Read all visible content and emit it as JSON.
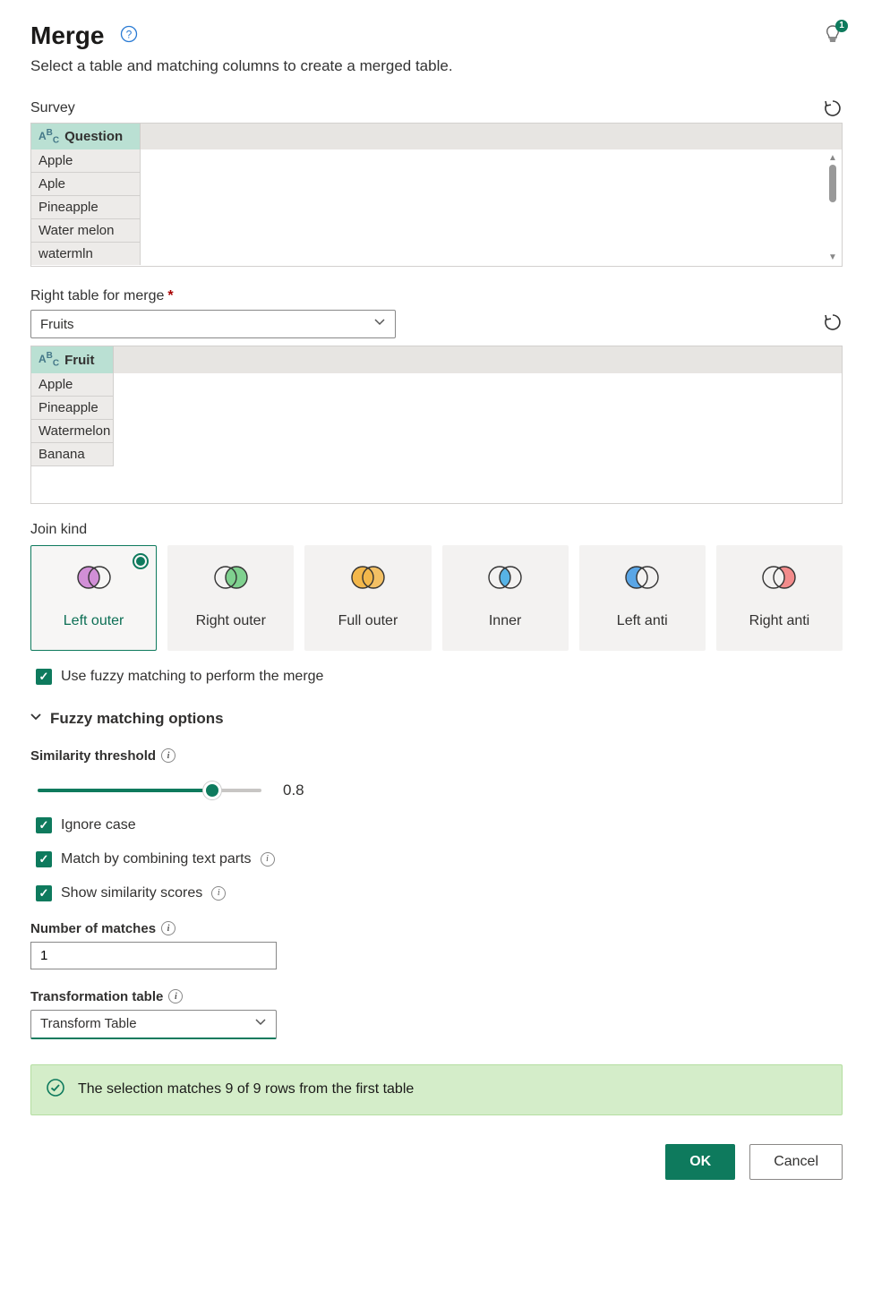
{
  "header": {
    "title": "Merge",
    "subtitle": "Select a table and matching columns to create a merged table.",
    "tip_count": "1"
  },
  "left_table": {
    "label": "Survey",
    "column": "Question",
    "rows": [
      "Apple",
      "Aple",
      "Pineapple",
      "Water melon",
      "watermln"
    ]
  },
  "right_table": {
    "label": "Right table for merge",
    "selected": "Fruits",
    "column": "Fruit",
    "rows": [
      "Apple",
      "Pineapple",
      "Watermelon",
      "Banana"
    ]
  },
  "join": {
    "label": "Join kind",
    "options": [
      "Left outer",
      "Right outer",
      "Full outer",
      "Inner",
      "Left anti",
      "Right anti"
    ],
    "selected": "Left outer"
  },
  "fuzzy": {
    "use_label": "Use fuzzy matching to perform the merge",
    "options_label": "Fuzzy matching options",
    "threshold_label": "Similarity threshold",
    "threshold_value": "0.8",
    "ignore_case": "Ignore case",
    "combine_label": "Match by combining text parts",
    "show_scores": "Show similarity scores",
    "matches_label": "Number of matches",
    "matches_value": "1",
    "transform_label": "Transformation table",
    "transform_value": "Transform Table"
  },
  "status": "The selection matches 9 of 9 rows from the first table",
  "footer": {
    "ok": "OK",
    "cancel": "Cancel"
  }
}
